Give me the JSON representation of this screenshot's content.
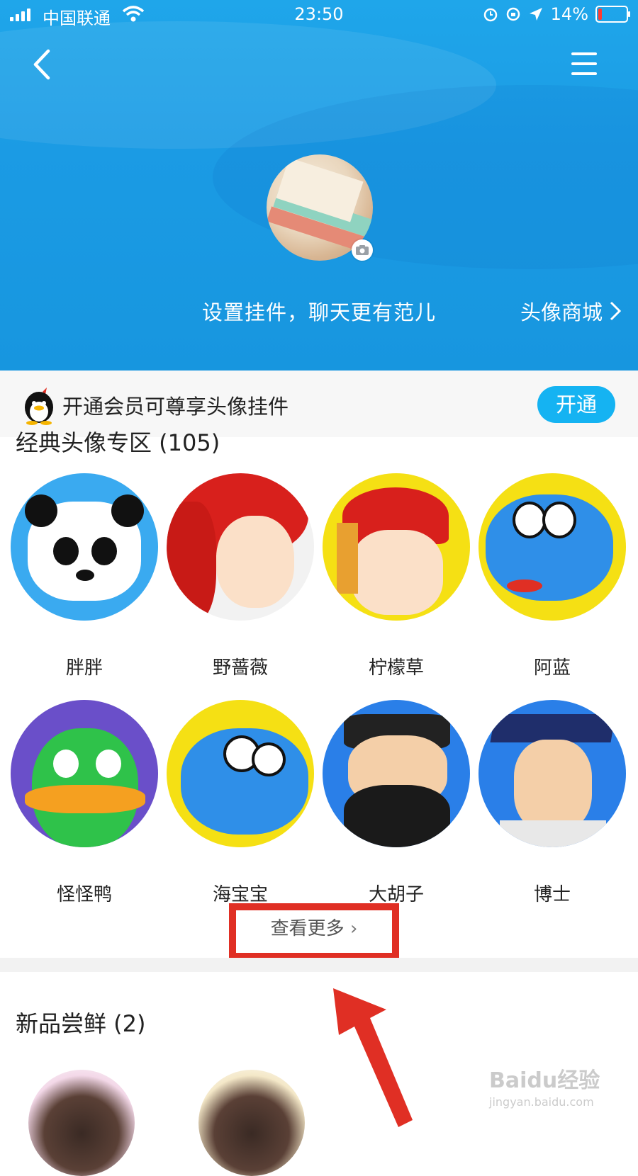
{
  "status_bar": {
    "carrier": "中国联通",
    "time": "23:50",
    "battery": "14%"
  },
  "header": {
    "tagline": "设置挂件，聊天更有范儿",
    "store_link": "头像商城"
  },
  "banner": {
    "text": "开通会员可尊享头像挂件",
    "button": "开通"
  },
  "classic_section": {
    "title": "经典头像专区 (105)",
    "items": [
      {
        "name": "胖胖",
        "bg": "#3aaaf0"
      },
      {
        "name": "野蔷薇",
        "bg": "#f2f2f2"
      },
      {
        "name": "柠檬草",
        "bg": "#f5e014"
      },
      {
        "name": "阿蓝",
        "bg": "#f5e014"
      },
      {
        "name": "怪怪鸭",
        "bg": "#6a4fc9"
      },
      {
        "name": "海宝宝",
        "bg": "#f5e014"
      },
      {
        "name": "大胡子",
        "bg": "#2a7fe8"
      },
      {
        "name": "博士",
        "bg": "#2a7fe8"
      }
    ],
    "more_link": "查看更多"
  },
  "new_section": {
    "title": "新品尝鲜 (2)"
  },
  "watermark": {
    "brand": "Baidu经验",
    "url": "jingyan.baidu.com"
  },
  "colors": {
    "header_blue": "#1b9be4",
    "accent": "#15b3f2",
    "highlight_red": "#e02f24"
  }
}
